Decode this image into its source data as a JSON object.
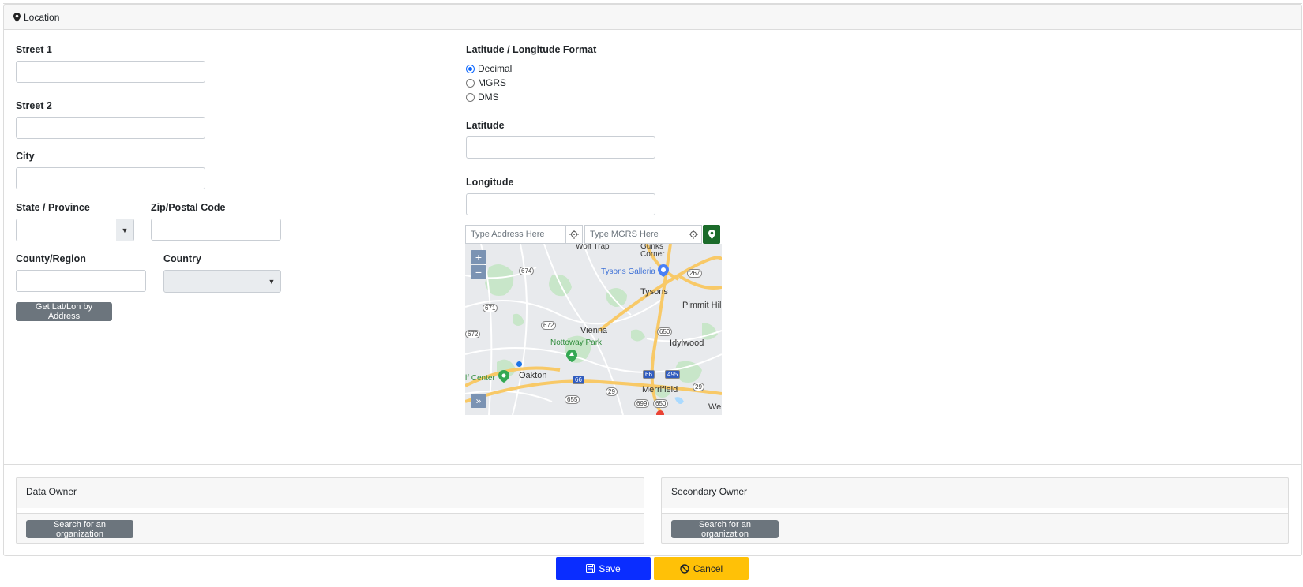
{
  "location": {
    "header": "Location",
    "fields": {
      "street1": {
        "label": "Street 1",
        "value": ""
      },
      "street2": {
        "label": "Street 2",
        "value": ""
      },
      "city": {
        "label": "City",
        "value": ""
      },
      "state": {
        "label": "State / Province",
        "value": ""
      },
      "zip": {
        "label": "Zip/Postal Code",
        "value": ""
      },
      "county": {
        "label": "County/Region",
        "value": ""
      },
      "country": {
        "label": "Country",
        "value": ""
      }
    },
    "get_latlon_button": "Get Lat/Lon by Address",
    "latlon_format": {
      "label": "Latitude / Longitude Format",
      "options": [
        "Decimal",
        "MGRS",
        "DMS"
      ],
      "selected": "Decimal"
    },
    "latitude": {
      "label": "Latitude",
      "value": ""
    },
    "longitude": {
      "label": "Longitude",
      "value": ""
    },
    "map": {
      "address_placeholder": "Type Address Here",
      "mgrs_placeholder": "Type MGRS Here",
      "zoom_in": "+",
      "zoom_out": "−",
      "expand": "»",
      "labels": {
        "tysons_galleria": "Tysons Galleria",
        "tysons": "Tysons",
        "pimmit_hills": "Pimmit Hil",
        "vienna": "Vienna",
        "nottoway_park": "Nottoway Park",
        "idylwood": "Idylwood",
        "oakton": "Oakton",
        "golf_center": "lf Center",
        "merrifield": "Merrifield",
        "west": "We",
        "corner": "Corner",
        "wolf_trap": "Wolf Trap",
        "gunks": "Gunks"
      },
      "route_shields": [
        "674",
        "671",
        "672",
        "672",
        "650",
        "650",
        "66",
        "66",
        "495",
        "29",
        "29",
        "655",
        "699",
        "650",
        "267",
        "495"
      ],
      "colors": {
        "water": "#aadaff",
        "park": "#c8e6c9",
        "highway": "#f8c967",
        "road": "#ffffff",
        "land": "#e8eaed"
      }
    }
  },
  "owners": {
    "data_owner": {
      "title": "Data Owner",
      "button": "Search for an organization"
    },
    "secondary_owner": {
      "title": "Secondary Owner",
      "button": "Search for an organization"
    }
  },
  "actions": {
    "save": "Save",
    "cancel": "Cancel"
  },
  "colors": {
    "save": "#0a2dff",
    "cancel": "#ffc107",
    "secondary_button": "#6c757d",
    "pin_button": "#1b6b2a"
  }
}
